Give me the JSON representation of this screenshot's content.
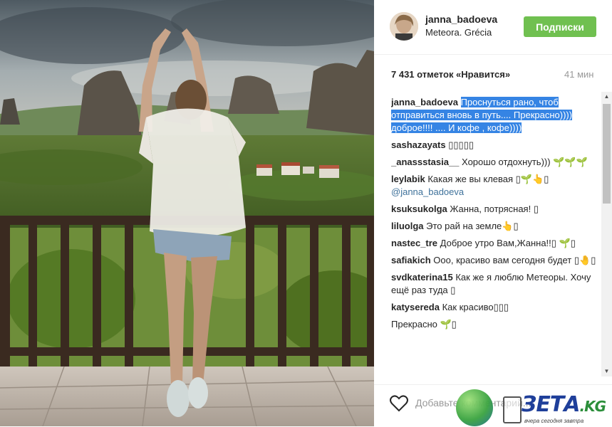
{
  "post": {
    "username": "janna_badoeva",
    "location": "Meteora. Grécia",
    "follow_label": "Подписки",
    "likes": "7 431 отметок «Нравится»",
    "time_ago": "41 мин",
    "add_comment_placeholder": "Добавьте комментарий...",
    "caption": {
      "author": "janna_badoeva",
      "text": "Проснуться рано, чтоб отправиться вновь в путь.... Прекрасно)))) доброе!!!! .... И кофе , кофе))))"
    },
    "comments": [
      {
        "author": "sashazayats",
        "text": "▯▯▯▯▯"
      },
      {
        "author": "_anassstasia__",
        "text": "Хорошо отдохнуть))) 🌱🌱🌱"
      },
      {
        "author": "leylabik",
        "text": "Какая же вы клевая ▯🌱👆▯",
        "mention": "@janna_badoeva"
      },
      {
        "author": "ksuksukolga",
        "text": "Жанна, потрясная! ▯"
      },
      {
        "author": "liluolga",
        "text": "Это рай на земле👆▯"
      },
      {
        "author": "nastec_tre",
        "text": "Доброе утро Вам,Жанна!!▯ 🌱▯"
      },
      {
        "author": "safiakich",
        "text": "Ооо, красиво вам сегодня будет ▯🤚▯"
      },
      {
        "author": "svdkaterina15",
        "text": "Как же я люблю Метеоры. Хочу ещё раз туда ▯"
      },
      {
        "author": "katysereda",
        "text": "Как красиво▯▯▯"
      },
      {
        "author": "",
        "text": "Прекрасно 🌱▯"
      }
    ]
  },
  "watermark": {
    "brand": "ЗЕТА",
    "tld": ".KG",
    "slogan": "вчера сегодня завтра"
  },
  "icons": {
    "heart": "heart-icon",
    "scroll_up": "arrow-up-icon",
    "scroll_down": "arrow-down-icon"
  },
  "colors": {
    "follow_button": "#70c050",
    "selection_highlight": "#3584e4",
    "mention": "#3f729b"
  }
}
